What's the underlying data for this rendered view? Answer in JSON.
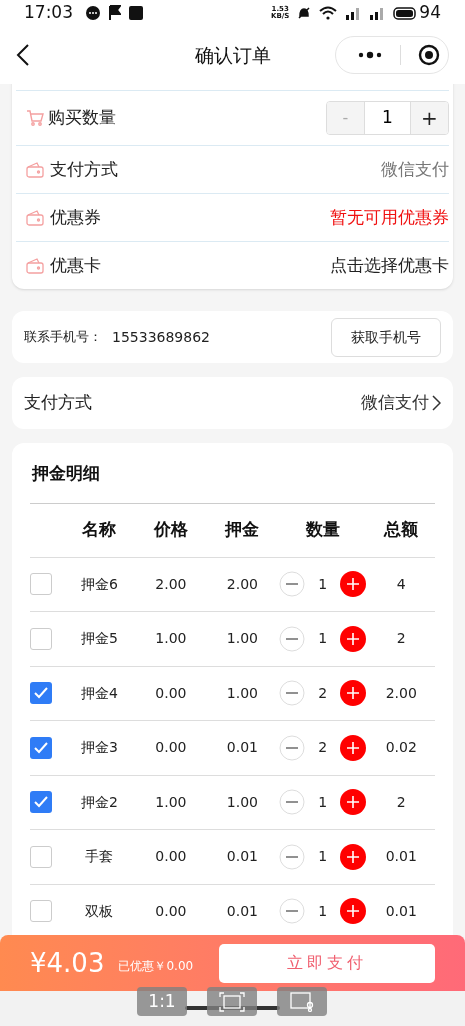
{
  "status_bar": {
    "time": "17:03",
    "speed": "1.53\nKB/S",
    "battery": "94"
  },
  "nav": {
    "title": "确认订单"
  },
  "order_card": {
    "quantity_row": {
      "label": "购买数量",
      "minus": "-",
      "value": "1",
      "plus": "+"
    },
    "rows": [
      {
        "label": "支付方式",
        "value": "微信支付",
        "kind": "muted"
      },
      {
        "label": "优惠券",
        "value": "暂无可用优惠券",
        "kind": "alert"
      },
      {
        "label": "优惠卡",
        "value": "点击选择优惠卡",
        "kind": "normal"
      }
    ]
  },
  "phone": {
    "label": "联系手机号：",
    "number": "15533689862",
    "button": "获取手机号"
  },
  "payment": {
    "label": "支付方式",
    "value": "微信支付"
  },
  "deposit": {
    "title": "押金明细",
    "columns": [
      "名称",
      "价格",
      "押金",
      "数量",
      "总额"
    ],
    "rows": [
      {
        "checked": false,
        "name": "押金6",
        "price": "2.00",
        "deposit": "2.00",
        "qty": "1",
        "total": "4"
      },
      {
        "checked": false,
        "name": "押金5",
        "price": "1.00",
        "deposit": "1.00",
        "qty": "1",
        "total": "2"
      },
      {
        "checked": true,
        "name": "押金4",
        "price": "0.00",
        "deposit": "1.00",
        "qty": "2",
        "total": "2.00"
      },
      {
        "checked": true,
        "name": "押金3",
        "price": "0.00",
        "deposit": "0.01",
        "qty": "2",
        "total": "0.02"
      },
      {
        "checked": true,
        "name": "押金2",
        "price": "1.00",
        "deposit": "1.00",
        "qty": "1",
        "total": "2"
      },
      {
        "checked": false,
        "name": "手套",
        "price": "0.00",
        "deposit": "0.01",
        "qty": "1",
        "total": "0.01"
      },
      {
        "checked": false,
        "name": "双板",
        "price": "0.00",
        "deposit": "0.01",
        "qty": "1",
        "total": "0.01"
      }
    ]
  },
  "footer": {
    "total": "¥4.03",
    "discount": "已优惠￥0.00",
    "pay_button": "立即支付"
  },
  "overlay": {
    "ratio_button": "1:1"
  }
}
